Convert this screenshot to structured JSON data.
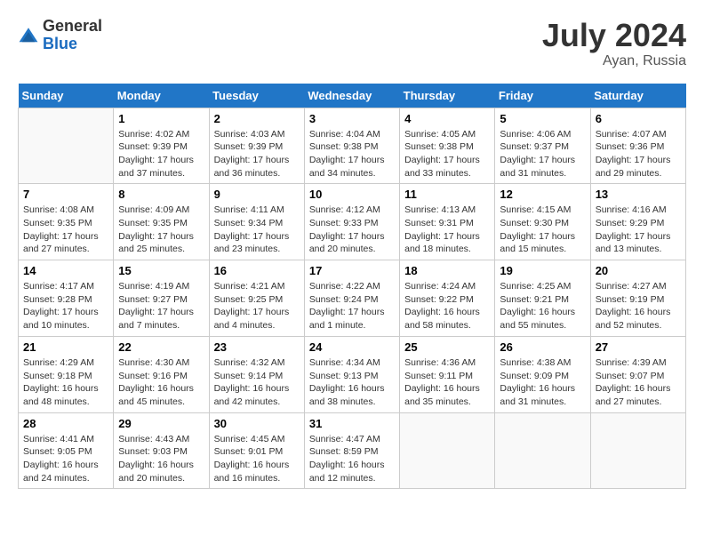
{
  "header": {
    "logo_general": "General",
    "logo_blue": "Blue",
    "month_year": "July 2024",
    "location": "Ayan, Russia"
  },
  "days_of_week": [
    "Sunday",
    "Monday",
    "Tuesday",
    "Wednesday",
    "Thursday",
    "Friday",
    "Saturday"
  ],
  "weeks": [
    [
      {
        "num": "",
        "sunrise": "",
        "sunset": "",
        "daylight": "",
        "empty": true
      },
      {
        "num": "1",
        "sunrise": "Sunrise: 4:02 AM",
        "sunset": "Sunset: 9:39 PM",
        "daylight": "Daylight: 17 hours and 37 minutes."
      },
      {
        "num": "2",
        "sunrise": "Sunrise: 4:03 AM",
        "sunset": "Sunset: 9:39 PM",
        "daylight": "Daylight: 17 hours and 36 minutes."
      },
      {
        "num": "3",
        "sunrise": "Sunrise: 4:04 AM",
        "sunset": "Sunset: 9:38 PM",
        "daylight": "Daylight: 17 hours and 34 minutes."
      },
      {
        "num": "4",
        "sunrise": "Sunrise: 4:05 AM",
        "sunset": "Sunset: 9:38 PM",
        "daylight": "Daylight: 17 hours and 33 minutes."
      },
      {
        "num": "5",
        "sunrise": "Sunrise: 4:06 AM",
        "sunset": "Sunset: 9:37 PM",
        "daylight": "Daylight: 17 hours and 31 minutes."
      },
      {
        "num": "6",
        "sunrise": "Sunrise: 4:07 AM",
        "sunset": "Sunset: 9:36 PM",
        "daylight": "Daylight: 17 hours and 29 minutes."
      }
    ],
    [
      {
        "num": "7",
        "sunrise": "Sunrise: 4:08 AM",
        "sunset": "Sunset: 9:35 PM",
        "daylight": "Daylight: 17 hours and 27 minutes."
      },
      {
        "num": "8",
        "sunrise": "Sunrise: 4:09 AM",
        "sunset": "Sunset: 9:35 PM",
        "daylight": "Daylight: 17 hours and 25 minutes."
      },
      {
        "num": "9",
        "sunrise": "Sunrise: 4:11 AM",
        "sunset": "Sunset: 9:34 PM",
        "daylight": "Daylight: 17 hours and 23 minutes."
      },
      {
        "num": "10",
        "sunrise": "Sunrise: 4:12 AM",
        "sunset": "Sunset: 9:33 PM",
        "daylight": "Daylight: 17 hours and 20 minutes."
      },
      {
        "num": "11",
        "sunrise": "Sunrise: 4:13 AM",
        "sunset": "Sunset: 9:31 PM",
        "daylight": "Daylight: 17 hours and 18 minutes."
      },
      {
        "num": "12",
        "sunrise": "Sunrise: 4:15 AM",
        "sunset": "Sunset: 9:30 PM",
        "daylight": "Daylight: 17 hours and 15 minutes."
      },
      {
        "num": "13",
        "sunrise": "Sunrise: 4:16 AM",
        "sunset": "Sunset: 9:29 PM",
        "daylight": "Daylight: 17 hours and 13 minutes."
      }
    ],
    [
      {
        "num": "14",
        "sunrise": "Sunrise: 4:17 AM",
        "sunset": "Sunset: 9:28 PM",
        "daylight": "Daylight: 17 hours and 10 minutes."
      },
      {
        "num": "15",
        "sunrise": "Sunrise: 4:19 AM",
        "sunset": "Sunset: 9:27 PM",
        "daylight": "Daylight: 17 hours and 7 minutes."
      },
      {
        "num": "16",
        "sunrise": "Sunrise: 4:21 AM",
        "sunset": "Sunset: 9:25 PM",
        "daylight": "Daylight: 17 hours and 4 minutes."
      },
      {
        "num": "17",
        "sunrise": "Sunrise: 4:22 AM",
        "sunset": "Sunset: 9:24 PM",
        "daylight": "Daylight: 17 hours and 1 minute."
      },
      {
        "num": "18",
        "sunrise": "Sunrise: 4:24 AM",
        "sunset": "Sunset: 9:22 PM",
        "daylight": "Daylight: 16 hours and 58 minutes."
      },
      {
        "num": "19",
        "sunrise": "Sunrise: 4:25 AM",
        "sunset": "Sunset: 9:21 PM",
        "daylight": "Daylight: 16 hours and 55 minutes."
      },
      {
        "num": "20",
        "sunrise": "Sunrise: 4:27 AM",
        "sunset": "Sunset: 9:19 PM",
        "daylight": "Daylight: 16 hours and 52 minutes."
      }
    ],
    [
      {
        "num": "21",
        "sunrise": "Sunrise: 4:29 AM",
        "sunset": "Sunset: 9:18 PM",
        "daylight": "Daylight: 16 hours and 48 minutes."
      },
      {
        "num": "22",
        "sunrise": "Sunrise: 4:30 AM",
        "sunset": "Sunset: 9:16 PM",
        "daylight": "Daylight: 16 hours and 45 minutes."
      },
      {
        "num": "23",
        "sunrise": "Sunrise: 4:32 AM",
        "sunset": "Sunset: 9:14 PM",
        "daylight": "Daylight: 16 hours and 42 minutes."
      },
      {
        "num": "24",
        "sunrise": "Sunrise: 4:34 AM",
        "sunset": "Sunset: 9:13 PM",
        "daylight": "Daylight: 16 hours and 38 minutes."
      },
      {
        "num": "25",
        "sunrise": "Sunrise: 4:36 AM",
        "sunset": "Sunset: 9:11 PM",
        "daylight": "Daylight: 16 hours and 35 minutes."
      },
      {
        "num": "26",
        "sunrise": "Sunrise: 4:38 AM",
        "sunset": "Sunset: 9:09 PM",
        "daylight": "Daylight: 16 hours and 31 minutes."
      },
      {
        "num": "27",
        "sunrise": "Sunrise: 4:39 AM",
        "sunset": "Sunset: 9:07 PM",
        "daylight": "Daylight: 16 hours and 27 minutes."
      }
    ],
    [
      {
        "num": "28",
        "sunrise": "Sunrise: 4:41 AM",
        "sunset": "Sunset: 9:05 PM",
        "daylight": "Daylight: 16 hours and 24 minutes."
      },
      {
        "num": "29",
        "sunrise": "Sunrise: 4:43 AM",
        "sunset": "Sunset: 9:03 PM",
        "daylight": "Daylight: 16 hours and 20 minutes."
      },
      {
        "num": "30",
        "sunrise": "Sunrise: 4:45 AM",
        "sunset": "Sunset: 9:01 PM",
        "daylight": "Daylight: 16 hours and 16 minutes."
      },
      {
        "num": "31",
        "sunrise": "Sunrise: 4:47 AM",
        "sunset": "Sunset: 8:59 PM",
        "daylight": "Daylight: 16 hours and 12 minutes."
      },
      {
        "num": "",
        "sunrise": "",
        "sunset": "",
        "daylight": "",
        "empty": true
      },
      {
        "num": "",
        "sunrise": "",
        "sunset": "",
        "daylight": "",
        "empty": true
      },
      {
        "num": "",
        "sunrise": "",
        "sunset": "",
        "daylight": "",
        "empty": true
      }
    ]
  ]
}
